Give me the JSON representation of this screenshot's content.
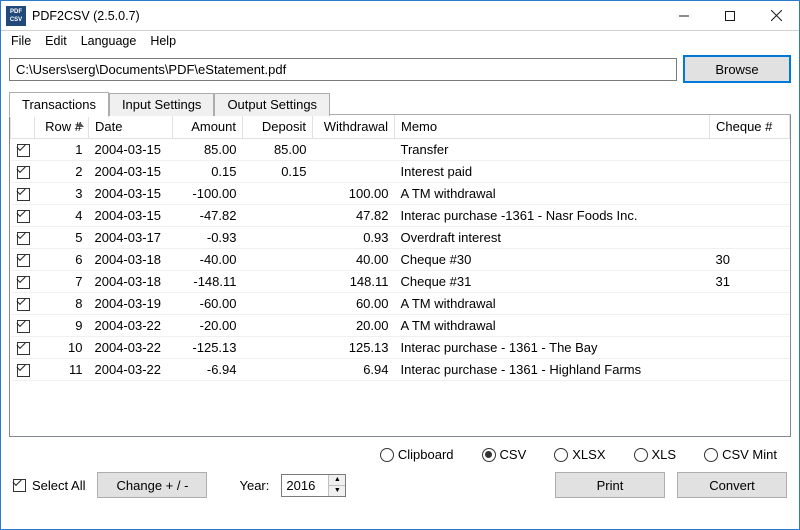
{
  "titlebar": {
    "title": "PDF2CSV (2.5.0.7)",
    "icon_top": "PDF",
    "icon_bot": "CSV"
  },
  "menu": {
    "file": "File",
    "edit": "Edit",
    "language": "Language",
    "help": "Help"
  },
  "path": {
    "value": "C:\\Users\\serg\\Documents\\PDF\\eStatement.pdf",
    "browse": "Browse"
  },
  "tabs": {
    "transactions": "Transactions",
    "input": "Input Settings",
    "output": "Output Settings"
  },
  "columns": {
    "row": "Row #",
    "date": "Date",
    "amount": "Amount",
    "deposit": "Deposit",
    "withdrawal": "Withdrawal",
    "memo": "Memo",
    "cheque": "Cheque #"
  },
  "rows": [
    {
      "n": "1",
      "date": "2004-03-15",
      "amount": "85.00",
      "deposit": "85.00",
      "withdrawal": "",
      "memo": "Transfer",
      "cheque": ""
    },
    {
      "n": "2",
      "date": "2004-03-15",
      "amount": "0.15",
      "deposit": "0.15",
      "withdrawal": "",
      "memo": "Interest paid",
      "cheque": ""
    },
    {
      "n": "3",
      "date": "2004-03-15",
      "amount": "-100.00",
      "deposit": "",
      "withdrawal": "100.00",
      "memo": "A TM withdrawal",
      "cheque": ""
    },
    {
      "n": "4",
      "date": "2004-03-15",
      "amount": "-47.82",
      "deposit": "",
      "withdrawal": "47.82",
      "memo": "Interac purchase -1361 - Nasr Foods Inc.",
      "cheque": ""
    },
    {
      "n": "5",
      "date": "2004-03-17",
      "amount": "-0.93",
      "deposit": "",
      "withdrawal": "0.93",
      "memo": "Overdraft interest",
      "cheque": ""
    },
    {
      "n": "6",
      "date": "2004-03-18",
      "amount": "-40.00",
      "deposit": "",
      "withdrawal": "40.00",
      "memo": "Cheque #30",
      "cheque": "30"
    },
    {
      "n": "7",
      "date": "2004-03-18",
      "amount": "-148.11",
      "deposit": "",
      "withdrawal": "148.11",
      "memo": "Cheque #31",
      "cheque": "31"
    },
    {
      "n": "8",
      "date": "2004-03-19",
      "amount": "-60.00",
      "deposit": "",
      "withdrawal": "60.00",
      "memo": "A TM withdrawal",
      "cheque": ""
    },
    {
      "n": "9",
      "date": "2004-03-22",
      "amount": "-20.00",
      "deposit": "",
      "withdrawal": "20.00",
      "memo": "A TM withdrawal",
      "cheque": ""
    },
    {
      "n": "10",
      "date": "2004-03-22",
      "amount": "-125.13",
      "deposit": "",
      "withdrawal": "125.13",
      "memo": "Interac purchase - 1361 - The Bay",
      "cheque": ""
    },
    {
      "n": "11",
      "date": "2004-03-22",
      "amount": "-6.94",
      "deposit": "",
      "withdrawal": "6.94",
      "memo": "Interac purchase - 1361 - Highland Farms",
      "cheque": ""
    }
  ],
  "formats": {
    "clipboard": "Clipboard",
    "csv": "CSV",
    "xlsx": "XLSX",
    "xls": "XLS",
    "csvmint": "CSV Mint",
    "selected": "csv"
  },
  "bottom": {
    "select_all": "Select All",
    "change": "Change + / -",
    "year_label": "Year:",
    "year_value": "2016",
    "print": "Print",
    "convert": "Convert"
  }
}
